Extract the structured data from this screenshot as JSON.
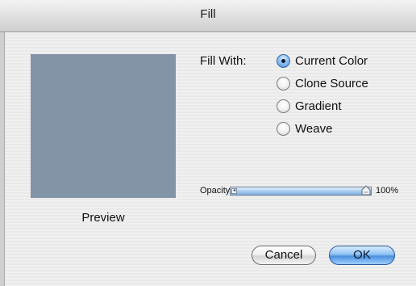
{
  "window": {
    "title": "Fill"
  },
  "preview": {
    "label": "Preview",
    "color": "#8294a6"
  },
  "fill_with": {
    "label": "Fill With:",
    "options": [
      {
        "label": "Current Color",
        "selected": true
      },
      {
        "label": "Clone Source",
        "selected": false
      },
      {
        "label": "Gradient",
        "selected": false
      },
      {
        "label": "Weave",
        "selected": false
      }
    ]
  },
  "opacity": {
    "label": "Opacity",
    "value_text": "100%",
    "value": 1.0
  },
  "buttons": {
    "cancel": "Cancel",
    "ok": "OK"
  },
  "colors": {
    "accent": "#4a8fdc",
    "preview_swatch": "#8294a6"
  }
}
